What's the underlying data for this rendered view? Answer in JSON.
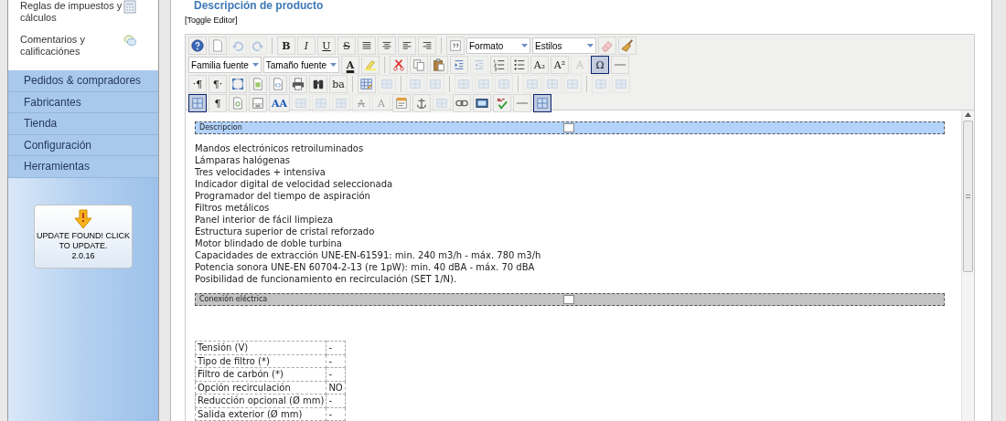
{
  "sidebar": {
    "items": [
      {
        "label": "Reglas de impuestos y cálculos",
        "kind": "calculator"
      },
      {
        "label": "Comentarios y calificaciónes",
        "kind": "chat"
      }
    ],
    "menu": [
      "Pedidos & compradores",
      "Fabricantes",
      "Tienda",
      "Configuración",
      "Herramientas"
    ],
    "update_button": {
      "label": "UPDATE FOUND! CLICK TO UPDATE.",
      "version": "2.0.16"
    }
  },
  "section_title": "Descripción de producto",
  "toggle_link": "[Toggle Editor]",
  "toolbar": {
    "rows": [
      {
        "items": [
          {
            "kind": "help",
            "disabled": false,
            "active": false
          },
          {
            "kind": "page",
            "disabled": false,
            "active": false
          },
          {
            "kind": "undo",
            "disabled": true,
            "active": false
          },
          {
            "kind": "redo",
            "disabled": true,
            "active": false
          },
          {
            "kind": "sep"
          },
          {
            "kind": "bold",
            "text": "B",
            "disabled": false,
            "active": false
          },
          {
            "kind": "italic",
            "text": "I",
            "disabled": false,
            "active": false
          },
          {
            "kind": "underline",
            "text": "U",
            "disabled": false,
            "active": false
          },
          {
            "kind": "strike",
            "text": "S",
            "disabled": false,
            "active": false
          },
          {
            "kind": "justify",
            "disabled": false,
            "active": false
          },
          {
            "kind": "center",
            "disabled": false,
            "active": false
          },
          {
            "kind": "left",
            "disabled": false,
            "active": false
          },
          {
            "kind": "right",
            "disabled": false,
            "active": false
          },
          {
            "kind": "sep"
          },
          {
            "kind": "quote",
            "disabled": false,
            "active": false
          },
          {
            "kind": "select",
            "text": "Formato",
            "disabled": false
          },
          {
            "kind": "select",
            "text": "Estilos",
            "disabled": false
          },
          {
            "kind": "eraser",
            "disabled": false,
            "active": false
          },
          {
            "kind": "broom",
            "disabled": false,
            "active": false
          }
        ]
      },
      {
        "items": [
          {
            "kind": "select",
            "text": "Familia fuente",
            "disabled": false
          },
          {
            "kind": "select",
            "text": "Tamaño fuente",
            "disabled": false
          },
          {
            "kind": "textcolor",
            "text": "A",
            "disabled": false,
            "active": false
          },
          {
            "kind": "highlight",
            "disabled": false,
            "active": false
          },
          {
            "kind": "sep"
          },
          {
            "kind": "cut",
            "disabled": false,
            "active": false
          },
          {
            "kind": "copy",
            "disabled": false,
            "active": false
          },
          {
            "kind": "paste",
            "disabled": false,
            "active": false
          },
          {
            "kind": "indent",
            "disabled": false,
            "active": false
          },
          {
            "kind": "outdent",
            "disabled": true,
            "active": false
          },
          {
            "kind": "ol",
            "disabled": false,
            "active": false
          },
          {
            "kind": "ul",
            "disabled": false,
            "active": false
          },
          {
            "kind": "glyph",
            "text": "A₂",
            "disabled": false,
            "active": false
          },
          {
            "kind": "glyph",
            "text": "A²",
            "disabled": false,
            "active": false
          },
          {
            "kind": "clearformat",
            "disabled": true,
            "active": false
          },
          {
            "kind": "glyph",
            "text": "Ω",
            "disabled": false,
            "active": true
          },
          {
            "kind": "hr",
            "disabled": false,
            "active": false
          }
        ]
      },
      {
        "items": [
          {
            "kind": "glyph",
            "text": "·¶",
            "disabled": false,
            "active": false
          },
          {
            "kind": "glyph",
            "text": "¶·",
            "disabled": false,
            "active": false
          },
          {
            "kind": "fullscreen",
            "disabled": false,
            "active": false
          },
          {
            "kind": "template",
            "disabled": false,
            "active": false
          },
          {
            "kind": "source",
            "disabled": false,
            "active": false
          },
          {
            "kind": "print",
            "disabled": false,
            "active": false
          },
          {
            "kind": "find",
            "disabled": false,
            "active": false
          },
          {
            "kind": "glyph",
            "text": "ba",
            "disabled": false,
            "active": false
          },
          {
            "kind": "sep"
          },
          {
            "kind": "table",
            "disabled": false,
            "active": false
          },
          {
            "kind": "cell",
            "disabled": true,
            "active": false
          },
          {
            "kind": "sep"
          },
          {
            "kind": "cell",
            "disabled": true,
            "active": false
          },
          {
            "kind": "cell",
            "disabled": true,
            "active": false
          },
          {
            "kind": "sep"
          },
          {
            "kind": "cell",
            "disabled": true,
            "active": false
          },
          {
            "kind": "cell",
            "disabled": true,
            "active": false
          },
          {
            "kind": "cell",
            "disabled": true,
            "active": false
          },
          {
            "kind": "sep"
          },
          {
            "kind": "cell",
            "disabled": true,
            "active": false
          },
          {
            "kind": "cell",
            "disabled": true,
            "active": false
          },
          {
            "kind": "cell",
            "disabled": true,
            "active": false
          },
          {
            "kind": "sep"
          },
          {
            "kind": "cell",
            "disabled": true,
            "active": false
          },
          {
            "kind": "cell",
            "disabled": true,
            "active": false
          }
        ]
      },
      {
        "items": [
          {
            "kind": "blocks",
            "disabled": false,
            "active": true
          },
          {
            "kind": "glyph",
            "text": "¶",
            "disabled": false,
            "active": false
          },
          {
            "kind": "preview",
            "disabled": false,
            "active": false
          },
          {
            "kind": "pagebreak",
            "disabled": false,
            "active": false
          },
          {
            "kind": "styles",
            "text": "AA",
            "disabled": false,
            "active": false
          },
          {
            "kind": "cell",
            "disabled": true,
            "active": false
          },
          {
            "kind": "cell",
            "disabled": true,
            "active": false
          },
          {
            "kind": "cell",
            "disabled": true,
            "active": false
          },
          {
            "kind": "strike",
            "text": "A",
            "disabled": true,
            "active": false
          },
          {
            "kind": "glyph",
            "text": "A",
            "disabled": true,
            "active": false
          },
          {
            "kind": "attributes",
            "disabled": false,
            "active": false
          },
          {
            "kind": "anchor",
            "disabled": false,
            "active": false
          },
          {
            "kind": "cell",
            "disabled": true,
            "active": false
          },
          {
            "kind": "link",
            "disabled": false,
            "active": false
          },
          {
            "kind": "image",
            "disabled": false,
            "active": false
          },
          {
            "kind": "spell",
            "disabled": false,
            "active": false
          },
          {
            "kind": "hr",
            "disabled": false,
            "active": false
          },
          {
            "kind": "blocks",
            "disabled": false,
            "active": true
          }
        ]
      }
    ]
  },
  "document": {
    "blocks": [
      {
        "kind": "section",
        "label": "Descripcion",
        "color": "#b3d3fb"
      },
      {
        "kind": "lines",
        "lines": [
          "Mandos electrónicos retroiluminados",
          "Lámparas halógenas",
          "Tres velocidades + intensiva",
          "Indicador digital de velocidad seleccionada",
          "Programador del tiempo de aspiración",
          "Filtros metálicos",
          "Panel interior de fácil limpieza",
          "Estructura superior de cristal reforzado",
          "Motor blindado de doble turbina",
          "Capacidades de extracción UNE-EN-61591: min. 240 m3/h - máx. 780 m3/h",
          "Potencia sonora UNE-EN 60704-2-13 (re 1pW): min. 40 dBA - máx. 70 dBA",
          "Posibilidad de funcionamiento en recirculación (SET 1/N)."
        ]
      },
      {
        "kind": "section",
        "label": "Conexión eléctrica",
        "color": "#c3c3c3"
      },
      {
        "kind": "table",
        "rows": [
          [
            "Tensión (V)",
            "-"
          ],
          [
            "Tipo de filtro (*)",
            "-"
          ],
          [
            "Filtro de carbón (*)",
            "-"
          ],
          [
            "Opción recirculación",
            "NO"
          ],
          [
            "Reducción opcional (Ø mm)",
            "-"
          ],
          [
            "Salida exterior (Ø mm)",
            "-"
          ]
        ]
      }
    ]
  }
}
